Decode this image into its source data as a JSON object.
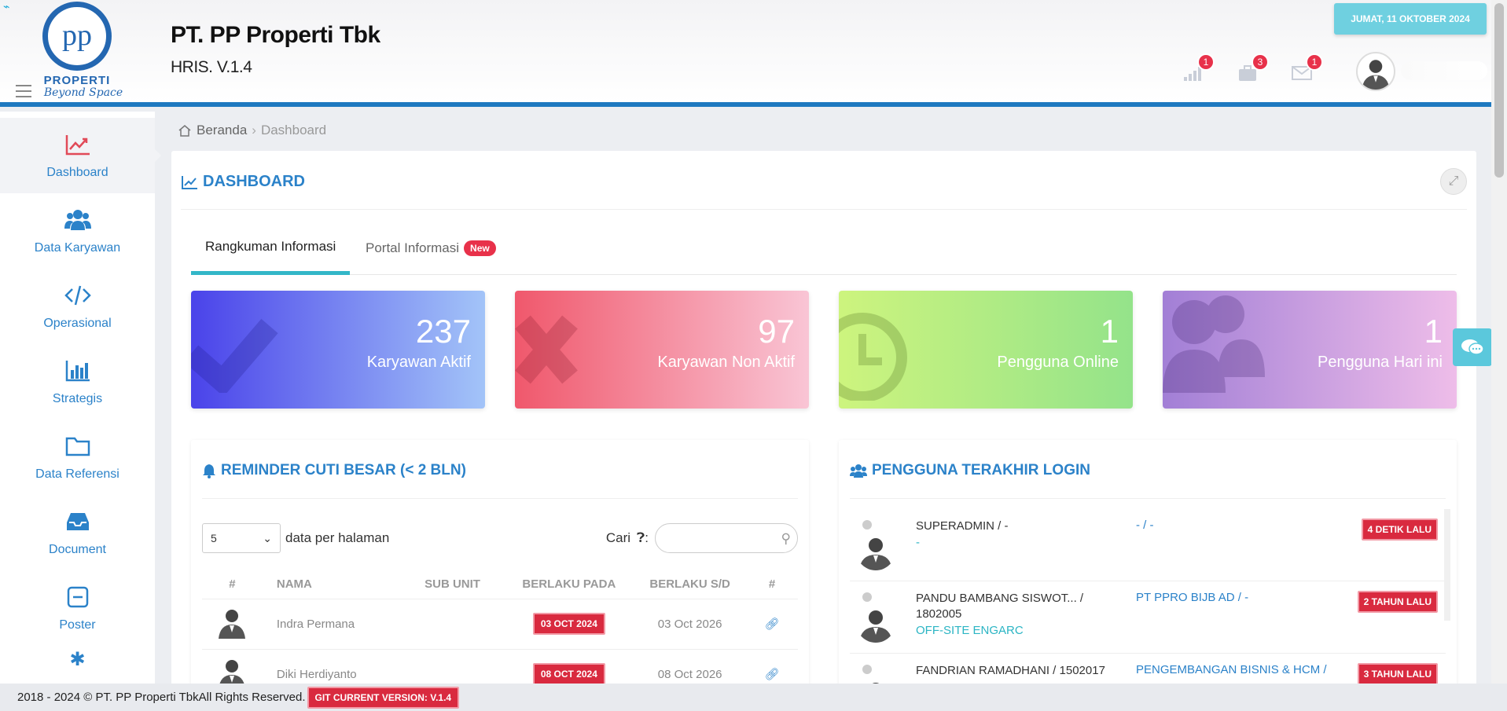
{
  "header": {
    "logo_text": "PP",
    "logo_sub": "PROPERTI",
    "logo_tagline": "Beyond Space",
    "company": "PT. PP Properti Tbk",
    "version": "HRIS. V.1.4",
    "date": "JUMAT, 11 OKTOBER 2024",
    "notifications": [
      {
        "icon": "signal-icon",
        "count": "1"
      },
      {
        "icon": "briefcase-icon",
        "count": "3"
      },
      {
        "icon": "mail-icon",
        "count": "1"
      }
    ]
  },
  "sidebar": {
    "items": [
      {
        "label": "Dashboard",
        "icon": "chart-line-icon",
        "active": true
      },
      {
        "label": "Data Karyawan",
        "icon": "users-icon"
      },
      {
        "label": "Operasional",
        "icon": "code-icon"
      },
      {
        "label": "Strategis",
        "icon": "bar-chart-icon"
      },
      {
        "label": "Data Referensi",
        "icon": "folder-icon"
      },
      {
        "label": "Document",
        "icon": "inbox-icon"
      },
      {
        "label": "Poster",
        "icon": "minus-square-icon"
      }
    ]
  },
  "breadcrumb": {
    "home": "Beranda",
    "current": "Dashboard"
  },
  "panel": {
    "title": "DASHBOARD",
    "tabs": [
      {
        "label": "Rangkuman Informasi",
        "active": true
      },
      {
        "label": "Portal Informasi",
        "badge": "New"
      }
    ]
  },
  "stats": [
    {
      "value": "237",
      "label": "Karyawan Aktif",
      "icon": "check-icon",
      "colors": [
        "#4a43ea",
        "#a3c4f8"
      ]
    },
    {
      "value": "97",
      "label": "Karyawan Non Aktif",
      "icon": "times-icon",
      "colors": [
        "#f0586c",
        "#f9c5d5"
      ]
    },
    {
      "value": "1",
      "label": "Pengguna Online",
      "icon": "clock-icon",
      "colors": [
        "#cdf47e",
        "#94e38a"
      ]
    },
    {
      "value": "1",
      "label": "Pengguna Hari ini",
      "icon": "users-icon",
      "colors": [
        "#a27fd6",
        "#eebde9"
      ]
    }
  ],
  "reminder": {
    "title": "REMINDER CUTI BESAR (< 2 BLN)",
    "page_size": "5",
    "per_page_label": "data per halaman",
    "search_label": "Cari",
    "columns": [
      "#",
      "NAMA",
      "SUB UNIT",
      "BERLAKU PADA",
      "BERLAKU S/D",
      "#"
    ],
    "rows": [
      {
        "name": "Indra Permana",
        "sub_unit": "",
        "from": "03 OCT 2024",
        "to": "03 Oct 2026"
      },
      {
        "name": "Diki Herdiyanto",
        "sub_unit": "",
        "from": "08 OCT 2024",
        "to": "08 Oct 2026"
      }
    ]
  },
  "last_login": {
    "title": "PENGGUNA TERAKHIR LOGIN",
    "rows": [
      {
        "name": "SUPERADMIN / -",
        "sub": "-",
        "unit": "- / -",
        "ago": "4 DETIK LALU"
      },
      {
        "name": "PANDU BAMBANG SISWOT... / 1802005",
        "sub": "OFF-SITE ENGARC",
        "unit": "PT PPRO BIJB AD / -",
        "ago": "2 TAHUN LALU"
      },
      {
        "name": "FANDRIAN RAMADHANI / 1502017",
        "sub": "",
        "unit": "PENGEMBANGAN BISNIS & HCM /",
        "ago": "3 TAHUN LALU"
      }
    ]
  },
  "footer": {
    "copyright": "2018 - 2024 © PT. PP Properti TbkAll Rights Reserved.",
    "git": "GIT CURRENT VERSION: V.1.4"
  }
}
